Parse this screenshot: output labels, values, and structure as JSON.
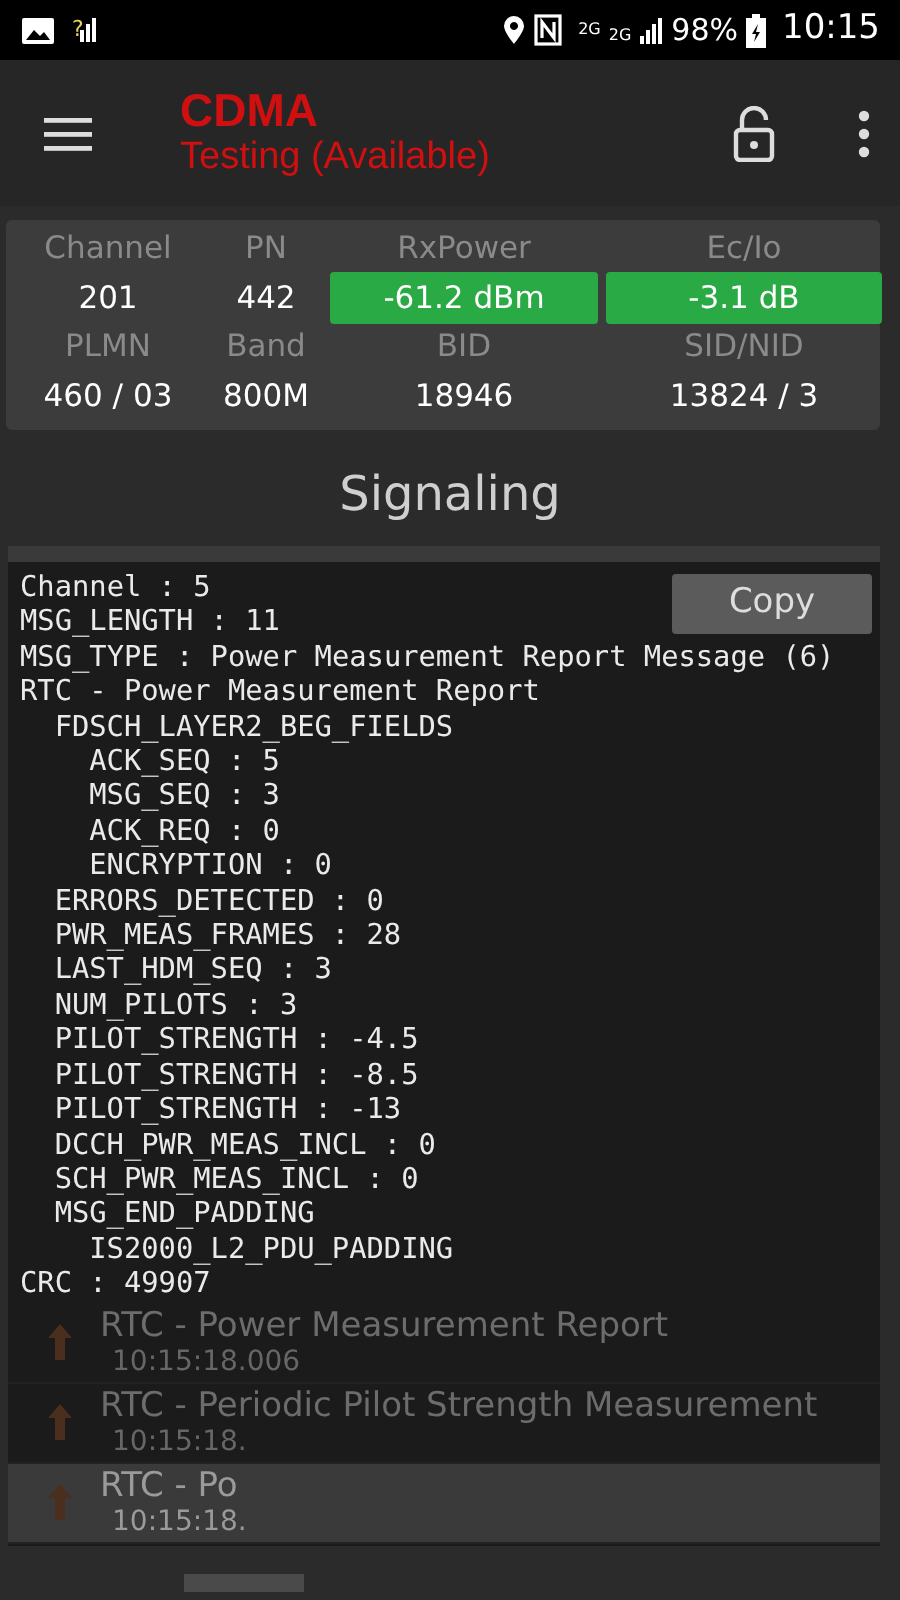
{
  "status_bar": {
    "sim_mark": "?",
    "network_label": "2G",
    "signal_label": "2G",
    "battery": "98%",
    "time": "10:15"
  },
  "toolbar": {
    "title": "CDMA",
    "subtitle": "Testing (Available)"
  },
  "info": [
    {
      "label": "Channel",
      "value": "201",
      "highlight": false
    },
    {
      "label": "PN",
      "value": "442",
      "highlight": false
    },
    {
      "label": "RxPower",
      "value": "-61.2 dBm",
      "highlight": true
    },
    {
      "label": "Ec/Io",
      "value": "-3.1 dB",
      "highlight": true
    },
    {
      "label": "PLMN",
      "value": "460 / 03",
      "highlight": false
    },
    {
      "label": "Band",
      "value": "800M",
      "highlight": false
    },
    {
      "label": "BID",
      "value": "18946",
      "highlight": false
    },
    {
      "label": "SID/NID",
      "value": "13824 / 3",
      "highlight": false
    }
  ],
  "section_title": "Signaling",
  "detail": {
    "copy_button": "Copy",
    "lines": [
      {
        "text": "Channel : 5"
      },
      {
        "text": "MSG_LENGTH : 11"
      },
      {
        "text": "MSG_TYPE : Power Measurement Report Message (6)"
      },
      {
        "text": "RTC - Power Measurement Report",
        "children": [
          {
            "text": "FDSCH_LAYER2_BEG_FIELDS",
            "children": [
              {
                "text": "ACK_SEQ : 5"
              },
              {
                "text": "MSG_SEQ : 3"
              },
              {
                "text": "ACK_REQ : 0"
              },
              {
                "text": "ENCRYPTION : 0"
              }
            ]
          },
          {
            "text": "ERRORS_DETECTED : 0"
          },
          {
            "text": "PWR_MEAS_FRAMES : 28"
          },
          {
            "text": "LAST_HDM_SEQ : 3"
          },
          {
            "text": "NUM_PILOTS : 3"
          },
          {
            "text": "PILOT_STRENGTH : -4.5"
          },
          {
            "text": "PILOT_STRENGTH : -8.5"
          },
          {
            "text": "PILOT_STRENGTH : -13"
          },
          {
            "text": "DCCH_PWR_MEAS_INCL : 0"
          },
          {
            "text": "SCH_PWR_MEAS_INCL : 0"
          },
          {
            "text": "MSG_END_PADDING",
            "children": [
              {
                "text": "IS2000_L2_PDU_PADDING"
              }
            ]
          }
        ]
      },
      {
        "text": "CRC : 49907"
      }
    ]
  },
  "messages": [
    {
      "title": "RTC - Power Measurement Report",
      "time": "10:15:18.006",
      "selected": false
    },
    {
      "title": "RTC - Periodic Pilot Strength Measurement",
      "time": "10:15:18.",
      "selected": false
    },
    {
      "title": "RTC - Po",
      "time": "10:15:18.",
      "selected": true
    }
  ]
}
